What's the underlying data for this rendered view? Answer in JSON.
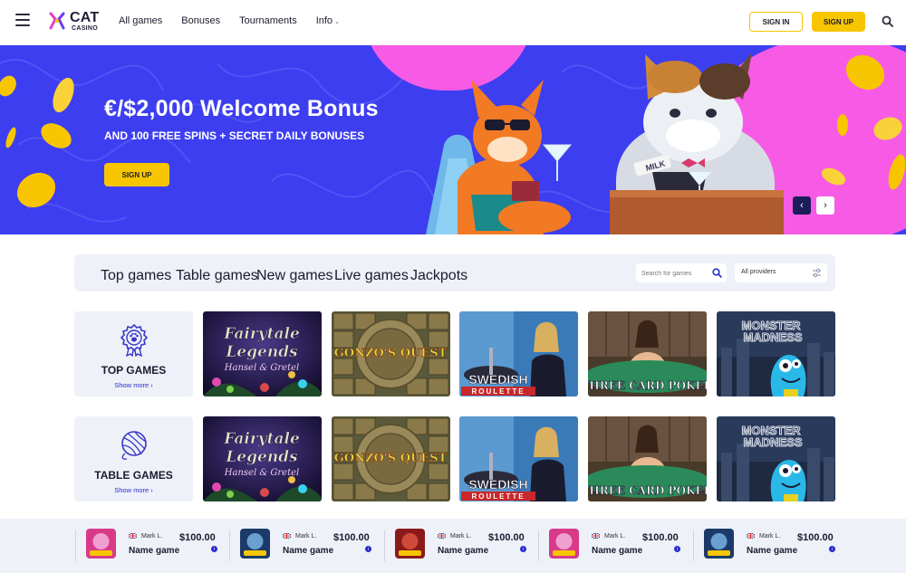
{
  "header": {
    "logo_main": "CAT",
    "logo_sub": "CASINO",
    "nav": [
      "All games",
      "Bonuses",
      "Tournaments",
      "Info"
    ],
    "signin": "SIGN IN",
    "signup": "SIGN UP"
  },
  "hero": {
    "title": "€/$2,000 Welcome Bonus",
    "subtitle": "AND 100 FREE SPINS + SECRET DAILY BONUSES",
    "button": "SIGN UP",
    "sign_text": "MILK",
    "colors": {
      "background": "#3d3ef0",
      "accent": "#f75be6",
      "cta": "#f7c600"
    }
  },
  "filter": {
    "tabs": [
      "Top games",
      "Table games",
      "New games",
      "Live games",
      "Jackpots"
    ],
    "search_placeholder": "Search for games",
    "provider": "All providers"
  },
  "rows": [
    {
      "category": "TOP GAMES",
      "more": "Show more",
      "icon": "paw-badge-icon",
      "games": [
        "Fairytale Legends",
        "Gonzo's Quest",
        "Swedish Roulette",
        "Three Card Poker",
        "Monster Madness"
      ]
    },
    {
      "category": "TABLE GAMES",
      "more": "Show more",
      "icon": "yarn-ball-icon",
      "games": [
        "Fairytale Legends",
        "Gonzo's Quest",
        "Swedish Roulette",
        "Three Card Poker",
        "Monster Madness"
      ]
    }
  ],
  "game_art": {
    "fairytale": {
      "line1": "Fairytale",
      "line2": "Legends",
      "line3": "Hansel & Gretel"
    },
    "gonzo": {
      "line1": "GONZO'S QUEST"
    },
    "swedish": {
      "line1": "SWEDISH",
      "line2": "ROULETTE"
    },
    "poker": {
      "line1": "THREE CARD POKER"
    },
    "monster": {
      "line1": "MONSTER",
      "line2": "MADNESS"
    }
  },
  "ticker": [
    {
      "user": "Mark L.",
      "amount": "$100.00",
      "game": "Name game"
    },
    {
      "user": "Mark L.",
      "amount": "$100.00",
      "game": "Name game"
    },
    {
      "user": "Mark L.",
      "amount": "$100.00",
      "game": "Name game"
    },
    {
      "user": "Mark L.",
      "amount": "$100.00",
      "game": "Name game"
    },
    {
      "user": "Mark L.",
      "amount": "$100.00",
      "game": "Name game"
    }
  ]
}
